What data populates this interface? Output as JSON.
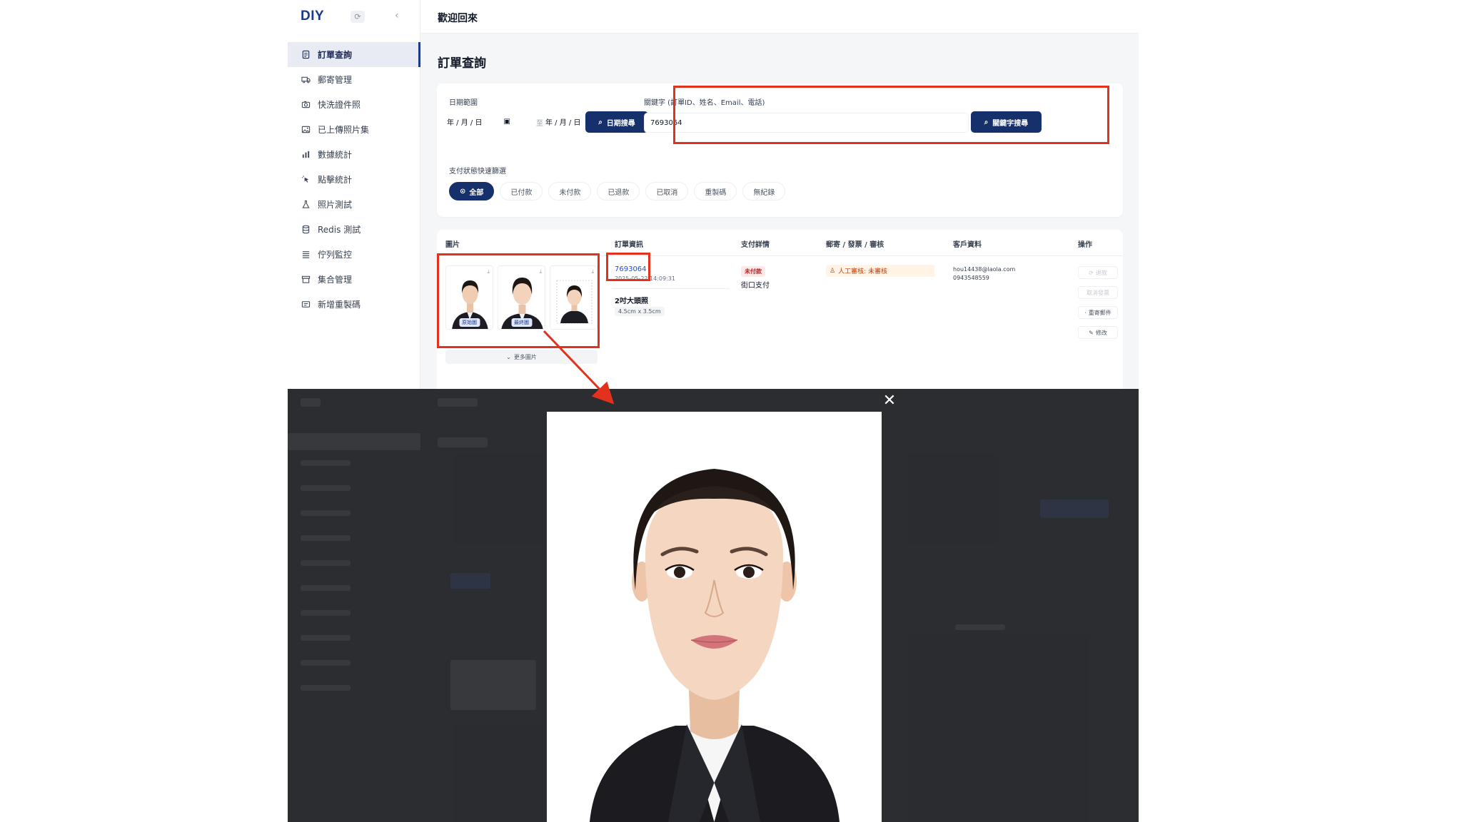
{
  "app": {
    "brand": "DIY",
    "welcome": "歡迎回來"
  },
  "sidebar": {
    "items": [
      {
        "label": "訂單查詢",
        "icon": "document-icon",
        "active": true
      },
      {
        "label": "郵寄管理",
        "icon": "truck-icon"
      },
      {
        "label": "快洗證件照",
        "icon": "camera-icon"
      },
      {
        "label": "已上傳照片集",
        "icon": "image-icon"
      },
      {
        "label": "數據統計",
        "icon": "bar-chart-icon"
      },
      {
        "label": "點擊統計",
        "icon": "pointer-icon"
      },
      {
        "label": "照片測試",
        "icon": "flask-icon"
      },
      {
        "label": "Redis 測試",
        "icon": "database-icon"
      },
      {
        "label": "佇列監控",
        "icon": "list-icon"
      },
      {
        "label": "集合管理",
        "icon": "archive-icon"
      },
      {
        "label": "新增重製碼",
        "icon": "ticket-icon"
      }
    ]
  },
  "page": {
    "title": "訂單查詢"
  },
  "filter": {
    "date_label": "日期範圍",
    "date_placeholder": "年 / 月 / 日",
    "to_label": "至",
    "date_search_label": "日期搜尋",
    "keyword_label": "關鍵字 (訂單ID、姓名、Email、電話)",
    "keyword_value": "7693064",
    "keyword_search_label": "關鍵字搜尋",
    "status_label": "支付狀態快速篩選",
    "status_chips": [
      "全部",
      "已付款",
      "未付款",
      "已退款",
      "已取消",
      "重製碼",
      "無紀錄"
    ]
  },
  "table": {
    "headers": [
      "圖片",
      "訂單資訊",
      "支付詳情",
      "郵寄 / 發票 / 審核",
      "客戶資料",
      "操作"
    ],
    "row": {
      "thumb_tags": [
        "原始圖",
        "最終圖"
      ],
      "more_images": "更多圖片",
      "order_id": "7693064",
      "order_time": "2025-05-22 14:09:31",
      "product": "2吋大頭照",
      "size": "4.5cm x 3.5cm",
      "pay_status": "未付款",
      "pay_method": "街口支付",
      "review": "人工審核: 未審核",
      "email": "hou14438@laola.com",
      "phone": "0943548559",
      "actions": [
        "退款",
        "取消發票",
        "重寄郵件",
        "修改"
      ]
    }
  },
  "modal": {
    "close": "✕"
  },
  "colors": {
    "primary": "#16306b",
    "annotation": "#e2311d",
    "link": "#1d4ed8"
  }
}
